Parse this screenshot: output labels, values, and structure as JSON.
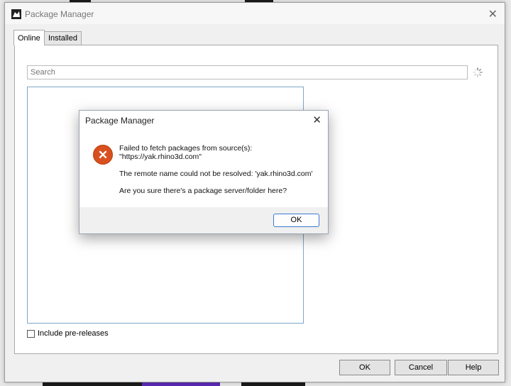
{
  "window": {
    "title": "Package Manager",
    "close_glyph": "✕",
    "app_icon": "rhino-icon"
  },
  "tabs": [
    {
      "label": "Online",
      "active": true
    },
    {
      "label": "Installed",
      "active": false
    }
  ],
  "search": {
    "placeholder": "Search",
    "value": ""
  },
  "loading_icon": "spinner-icon",
  "prerelease": {
    "label": "Include pre-releases",
    "checked": false
  },
  "buttons": {
    "ok": "OK",
    "cancel": "Cancel",
    "help": "Help"
  },
  "dialog": {
    "title": "Package Manager",
    "close_glyph": "✕",
    "icon": "error-icon",
    "icon_glyph": "✕",
    "message_line1": "Failed to fetch packages from source(s):",
    "message_line2": "\"https://yak.rhino3d.com\"",
    "message_line3": "The remote name could not be resolved: 'yak.rhino3d.com'",
    "message_line4": "Are you sure there's a package server/folder here?",
    "ok_label": "OK"
  },
  "colors": {
    "error": "#d9501f",
    "focus_border": "#3a7ad1",
    "list_border": "#7fa7c9"
  }
}
